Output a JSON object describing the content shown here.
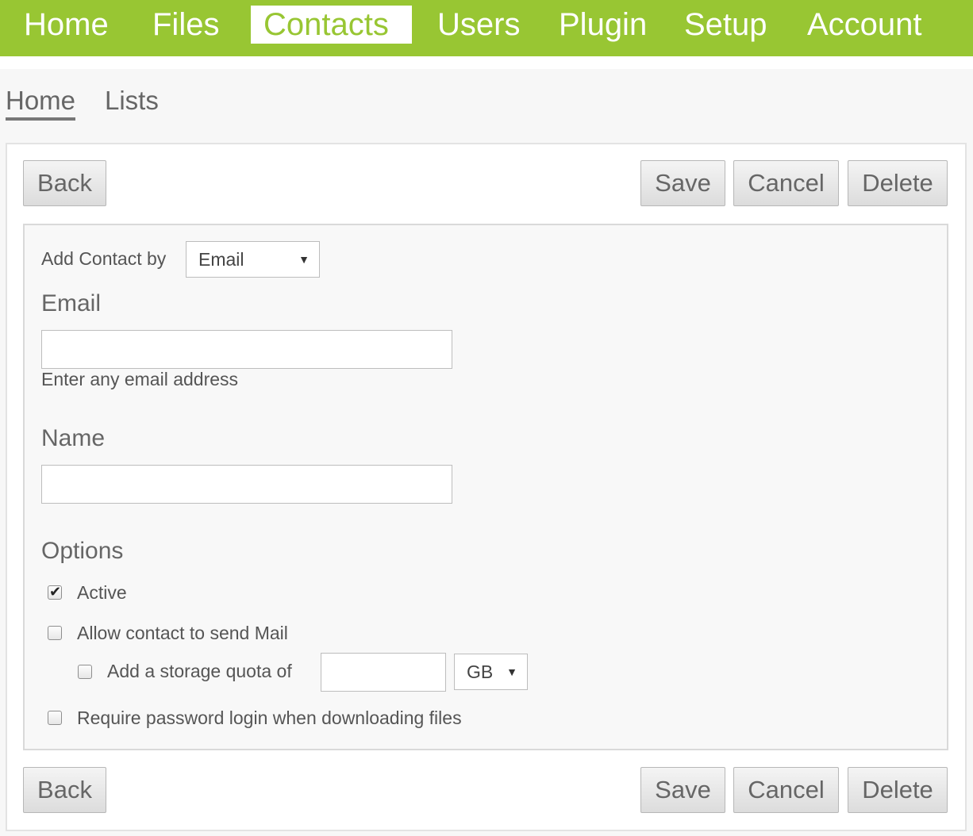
{
  "nav": {
    "items": [
      "Home",
      "Files",
      "Contacts",
      "Users",
      "Plugin",
      "Setup",
      "Account"
    ],
    "active": "Contacts"
  },
  "subnav": {
    "home": "Home",
    "lists": "Lists"
  },
  "buttons": {
    "back": "Back",
    "save": "Save",
    "cancel": "Cancel",
    "delete": "Delete"
  },
  "form": {
    "add_contact_by_label": "Add Contact by",
    "add_contact_by_value": "Email",
    "email_heading": "Email",
    "email_value": "",
    "email_hint": "Enter any email address",
    "name_heading": "Name",
    "name_value": "",
    "options_heading": "Options",
    "options": {
      "active": {
        "label": "Active",
        "checked": true
      },
      "allow_send_mail": {
        "label": "Allow contact to send Mail",
        "checked": false
      },
      "storage_quota": {
        "label": "Add a storage quota of",
        "checked": false,
        "value": "",
        "unit": "GB"
      },
      "require_password": {
        "label": "Require password login when downloading files",
        "checked": false
      }
    }
  },
  "colors": {
    "nav_bg": "#98c633",
    "nav_active_text": "#98c633"
  }
}
